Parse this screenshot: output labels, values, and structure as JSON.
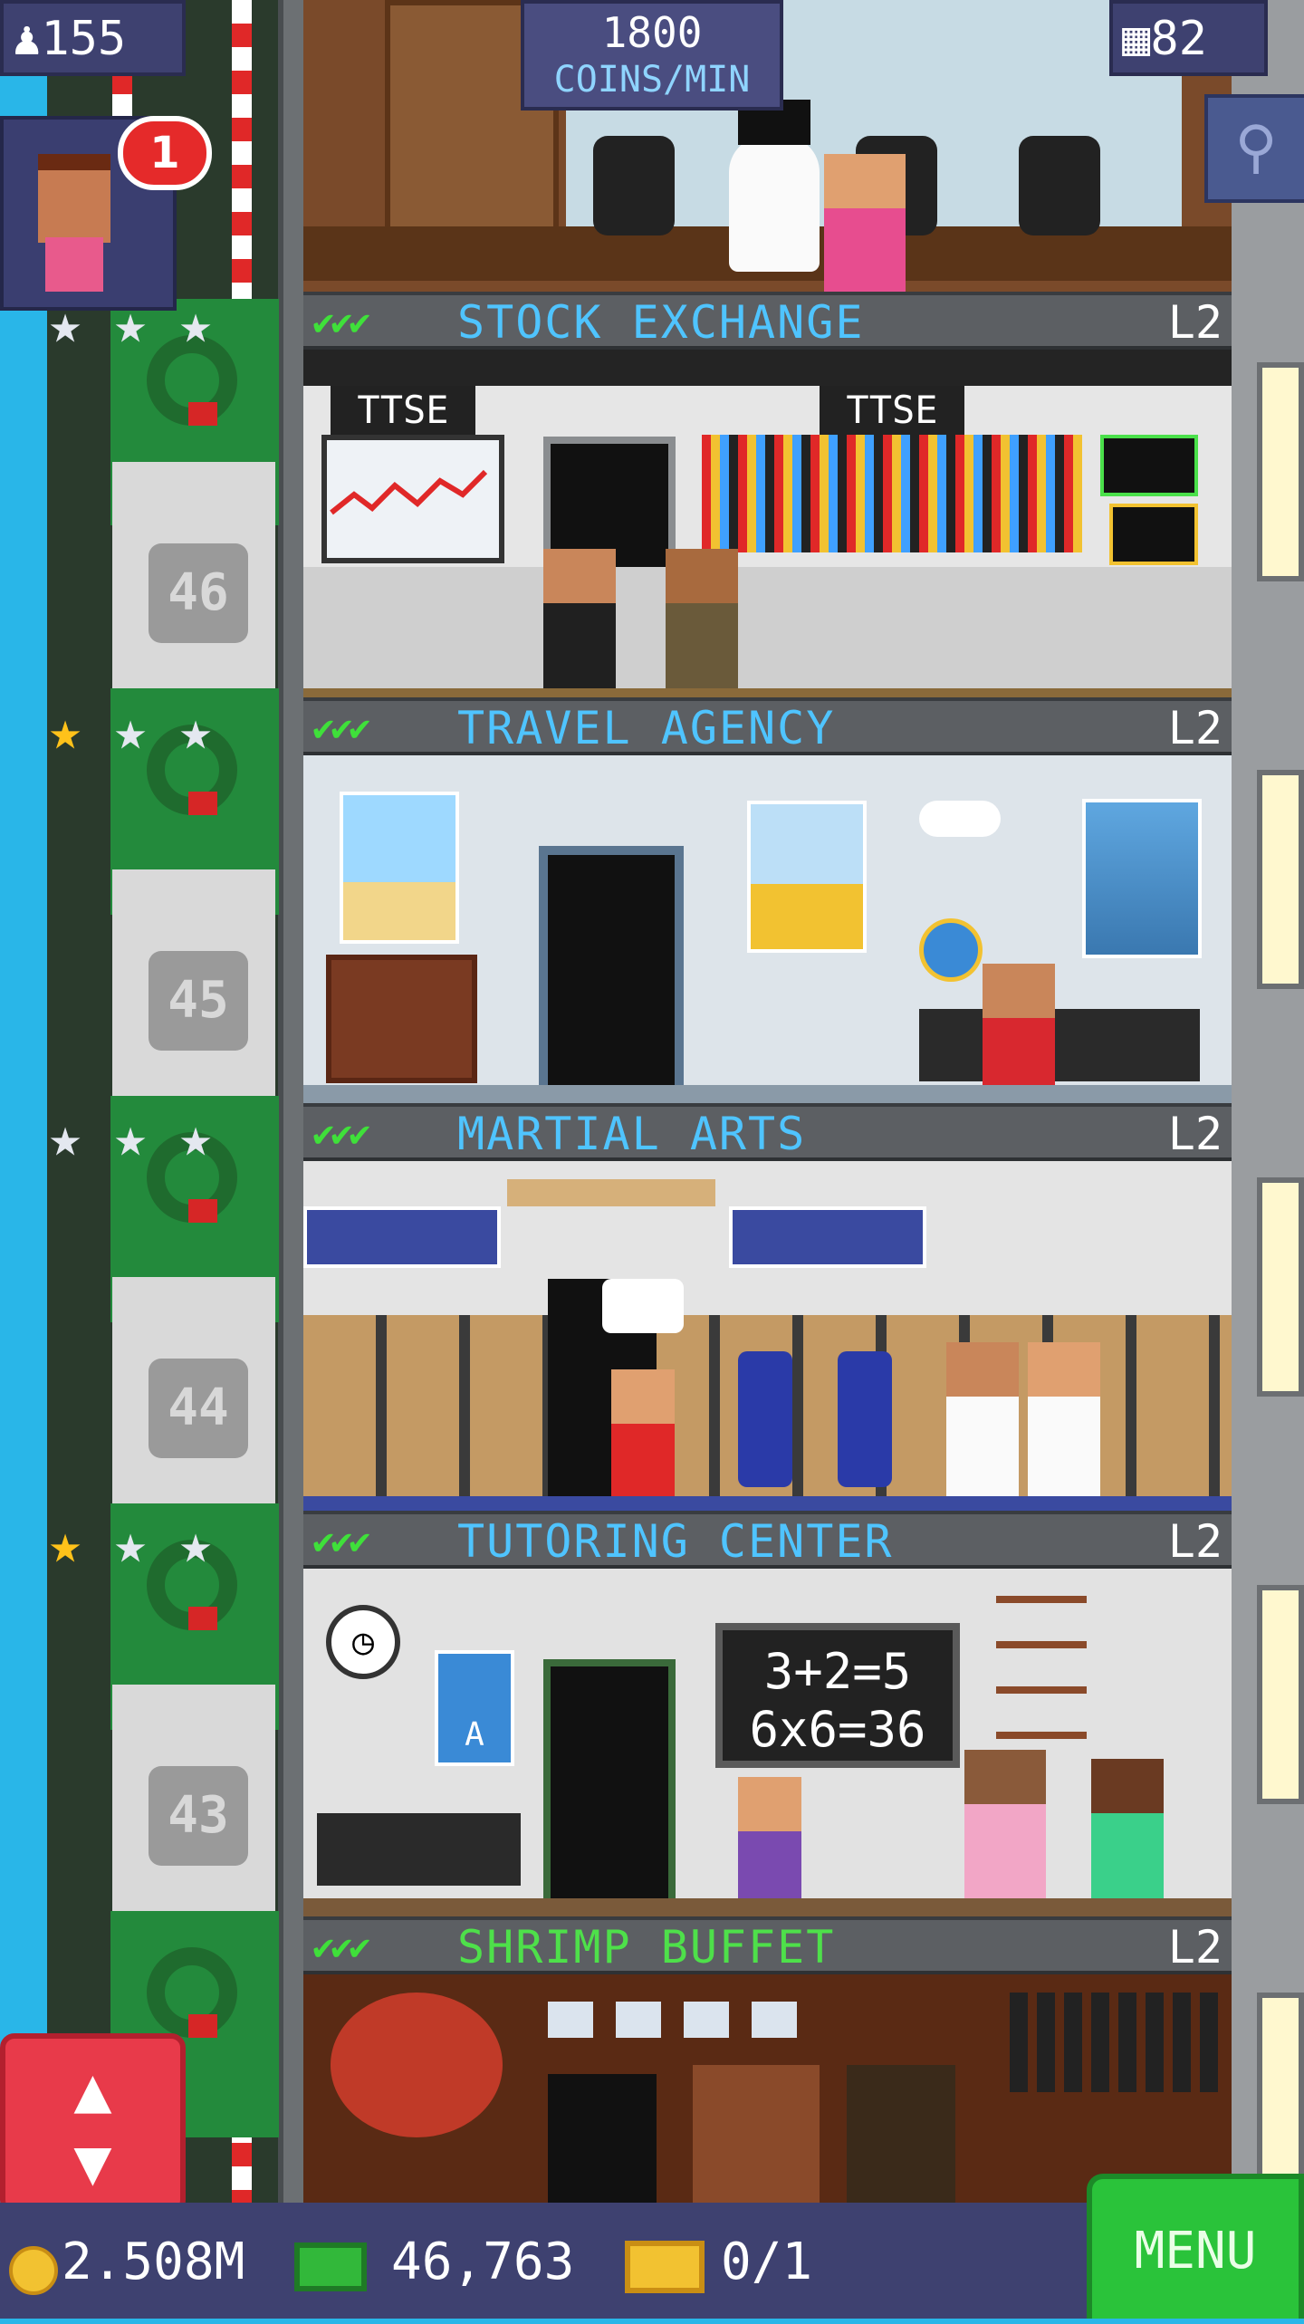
{
  "hud": {
    "population": "155",
    "coins_per_min_value": "1800",
    "coins_per_min_unit": "COINS/MIN",
    "floors_count": "82",
    "visitor_badge": "1"
  },
  "icons": {
    "population": "person-icon",
    "floors": "building-icon",
    "search": "magnifier-icon",
    "elevator": "up-down-arrows-icon",
    "coin": "coin-icon",
    "bux": "tower-bux-icon",
    "ticket": "vip-ticket-icon",
    "star": "star-icon"
  },
  "floor_numbers": [
    "46",
    "45",
    "44",
    "43"
  ],
  "floors": [
    {
      "name": "STOCK EXCHANGE",
      "level": "L2",
      "checks": "✔✔✔",
      "stars": [
        "silver",
        "silver",
        "silver"
      ],
      "sign_left": "TTSE",
      "sign_right": "TTSE"
    },
    {
      "name": "TRAVEL AGENCY",
      "level": "L2",
      "checks": "✔✔✔",
      "stars": [
        "gold",
        "silver",
        "silver"
      ]
    },
    {
      "name": "MARTIAL ARTS",
      "level": "L2",
      "checks": "✔✔✔",
      "stars": [
        "silver",
        "silver",
        "silver"
      ]
    },
    {
      "name": "TUTORING CENTER",
      "level": "L2",
      "checks": "✔✔✔",
      "stars": [
        "gold",
        "silver",
        "silver"
      ],
      "chalkboard_line1": "3+2=5",
      "chalkboard_line2": "6x6=36",
      "poster_letter": "A"
    },
    {
      "name": "SHRIMP BUFFET",
      "level": "L2",
      "checks": "✔✔✔"
    }
  ],
  "bottom_bar": {
    "coins": "2.508M",
    "bux": "46,763",
    "tickets": "0/1",
    "menu_label": "MENU"
  },
  "colors": {
    "sky": "#29b6e8",
    "floor_name_blue": "#4fc4ff",
    "floor_name_green": "#4ee04a",
    "menu_green": "#2ac33a",
    "hud_panel": "#3e4170"
  }
}
